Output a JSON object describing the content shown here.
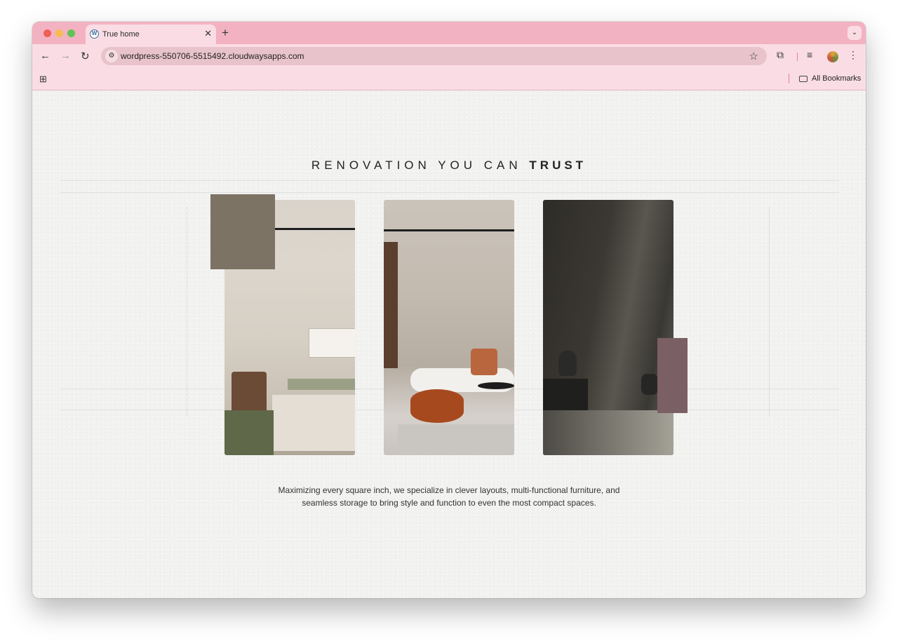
{
  "browser": {
    "tab_title": "True home",
    "tab_favicon": "wordpress-icon",
    "url": "wordpress-550706-5515492.cloudwaysapps.com",
    "bookmarks_label": "All Bookmarks"
  },
  "page": {
    "headline_plain": "RENOVATION YOU CAN",
    "headline_bold": "TRUST",
    "caption_line1": "Maximizing every square inch, we specialize in clever layouts, multi-functional furniture, and",
    "caption_line2": "seamless storage to bring style and function to even the most compact spaces."
  },
  "colors": {
    "tabstrip": "#f3b2c1",
    "toolbar": "#fadde4",
    "swatch_taupe": "#7c7364",
    "swatch_mauve": "#7a5f65"
  }
}
